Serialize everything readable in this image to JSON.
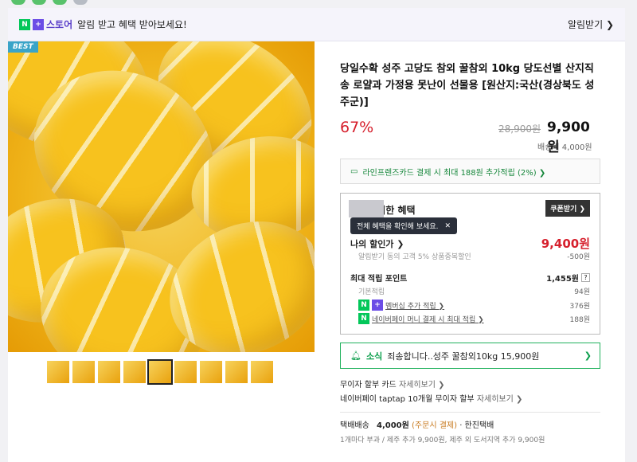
{
  "notification_bar": {
    "store_logo_text": "스토어",
    "message": "알림 받고 혜택 받아보세요!",
    "subscribe_label": "알림받기 ❯"
  },
  "product": {
    "badge": "BEST",
    "title": "당일수확 성주 고당도 참외 꿀참외 10kg 당도선별 산지직송 로얄과 가정용 못난이 선물용 [원산지:국산(경상북도 성주군)]",
    "discount_rate": "67%",
    "original_price": "28,900원",
    "sale_price": "9,900원",
    "shipping_fee": "배송비 4,000원",
    "thumbnail_count": 10,
    "active_thumbnail": 4
  },
  "card_promo": {
    "text": "라인프렌즈카드 결제 시 최대 188원 추가적립 (2%) ❯"
  },
  "benefits": {
    "title": "을 위한 혜택",
    "coupon_button": "쿠폰받기 ❯",
    "tooltip": "전체 혜택을 확인해 보세요.",
    "tooltip_close": "✕",
    "my_discount_label": "나의 할인가 ❯",
    "my_discount_price": "9,400원",
    "discount_detail": "알림받기 동의 고객 5% 상품중복할인",
    "discount_amount": "-500원",
    "max_points_label": "최대 적립 포인트",
    "max_points": "1,455원",
    "help": "?",
    "base_points_label": "기본적립",
    "base_points": "94원",
    "membership_label": "멤버십 추가 적립 ❯",
    "membership_points": "376원",
    "npay_label": "네이버페이 머니 결제 시 최대 적립 ❯",
    "npay_points": "188원"
  },
  "sale_news": {
    "tag": "소식",
    "text": "죄송합니다..성주 꿀참외10kg 15,900원",
    "arrow": "❯"
  },
  "installment": {
    "line1_label": "무이자 할부 카드",
    "line1_link": "자세히보기 ❯",
    "line2_label": "네이버페이 taptap 10개월 무이자 할부",
    "line2_link": "자세히보기 ❯"
  },
  "shipping": {
    "type": "택배배송",
    "fee": "4,000원",
    "pay_on_order": "(주문시 결제)",
    "courier": "· 한진택배",
    "detail": "1개마다 부과 / 제주 추가 9,900원, 제주 외 도서지역 추가 9,900원"
  }
}
